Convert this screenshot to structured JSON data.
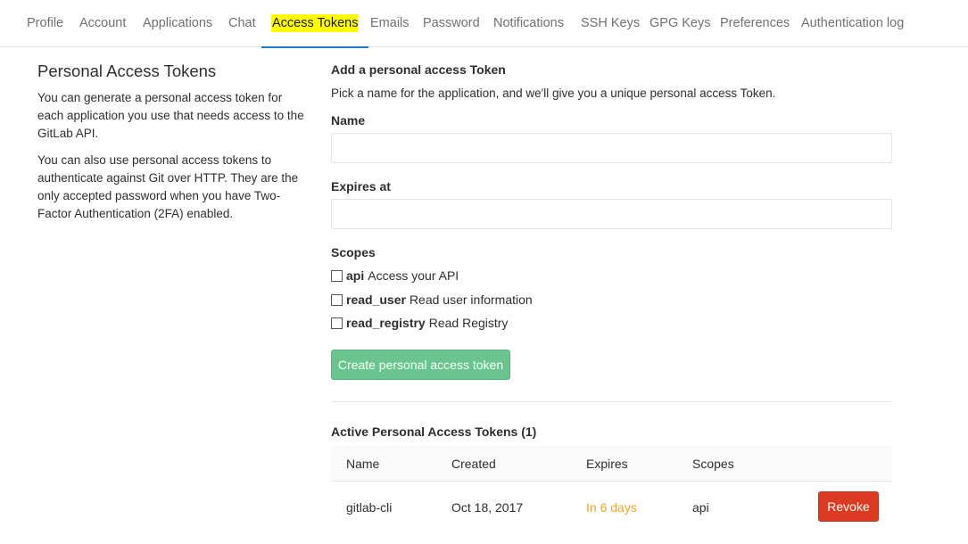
{
  "nav": {
    "items": [
      {
        "label": "Profile"
      },
      {
        "label": "Account"
      },
      {
        "label": "Applications"
      },
      {
        "label": "Chat"
      },
      {
        "label": "Access Tokens",
        "active": true
      },
      {
        "label": "Emails"
      },
      {
        "label": "Password"
      },
      {
        "label": "Notifications"
      },
      {
        "label": "SSH Keys"
      },
      {
        "label": "GPG Keys"
      },
      {
        "label": "Preferences"
      },
      {
        "label": "Authentication log"
      }
    ]
  },
  "sidebar": {
    "title": "Personal Access Tokens",
    "paragraph1": "You can generate a personal access token for each application you use that needs access to the GitLab API.",
    "paragraph2": "You can also use personal access tokens to authenticate against Git over HTTP. They are the only accepted password when you have Two-Factor Authentication (2FA) enabled."
  },
  "form": {
    "title": "Add a personal access Token",
    "description": "Pick a name for the application, and we'll give you a unique personal access Token.",
    "name_label": "Name",
    "name_value": "",
    "expires_label": "Expires at",
    "expires_value": "",
    "scopes_label": "Scopes",
    "scopes": [
      {
        "name": "api",
        "description": "Access your API",
        "checked": false
      },
      {
        "name": "read_user",
        "description": "Read user information",
        "checked": false
      },
      {
        "name": "read_registry",
        "description": "Read Registry",
        "checked": false
      }
    ],
    "submit_label": "Create personal access token"
  },
  "active_tokens": {
    "title": "Active Personal Access Tokens (1)",
    "columns": [
      "Name",
      "Created",
      "Expires",
      "Scopes"
    ],
    "rows": [
      {
        "name": "gitlab-cli",
        "created": "Oct 18, 2017",
        "expires": "In 6 days",
        "scopes": "api",
        "action": "Revoke"
      }
    ]
  },
  "colors": {
    "accent": "#1f78d1",
    "highlight": "#ffff00",
    "create_button": "#69c58d",
    "revoke_button": "#db3b21",
    "expires_warning": "#f0a52f"
  }
}
